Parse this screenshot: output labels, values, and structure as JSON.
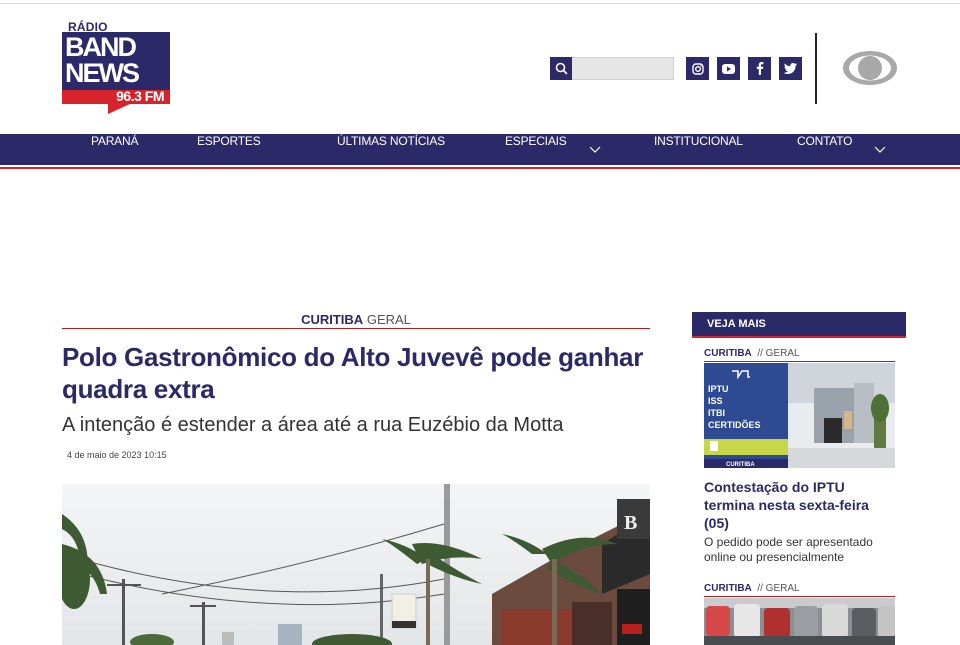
{
  "header": {
    "logo": {
      "radio": "RÁDIO",
      "band": "BAND",
      "news": "NEWS",
      "frequency": "96.3 FM"
    },
    "search": {
      "placeholder": ""
    },
    "socials": [
      "instagram-icon",
      "youtube-icon",
      "facebook-icon",
      "twitter-icon"
    ],
    "colors": {
      "brand_blue": "#2b2968",
      "brand_red": "#d7242a"
    }
  },
  "nav": {
    "items": [
      {
        "label": "PARANÁ"
      },
      {
        "label": "ESPORTES"
      },
      {
        "label": "ÚLTIMAS NOTÍCIAS"
      },
      {
        "label": "ESPECIAIS"
      },
      {
        "label": "INSTITUCIONAL"
      },
      {
        "label": "CONTATO"
      }
    ]
  },
  "article": {
    "category": "CURITIBA",
    "subcategory": "GERAL",
    "title": "Polo Gastronômico do Alto Juvevê pode ganhar quadra extra",
    "subtitle": "A intenção é estender a área até a rua Euzébio da Motta",
    "date": "4 de maio de 2023 10:15"
  },
  "sidebar": {
    "heading": "VEJA MAIS",
    "items": [
      {
        "category": "CURITIBA",
        "subcategory": "// GERAL",
        "title": "Contestação do IPTU termina nesta sexta-feira (05)",
        "description": "O pedido pode ser apresentado online ou presencialmente",
        "image_text": [
          "IPTU",
          "ISS",
          "ITBI",
          "CERTIDÕES"
        ],
        "image_caption": "CURITIBA"
      },
      {
        "category": "CURITIBA",
        "subcategory": "// GERAL"
      }
    ]
  }
}
